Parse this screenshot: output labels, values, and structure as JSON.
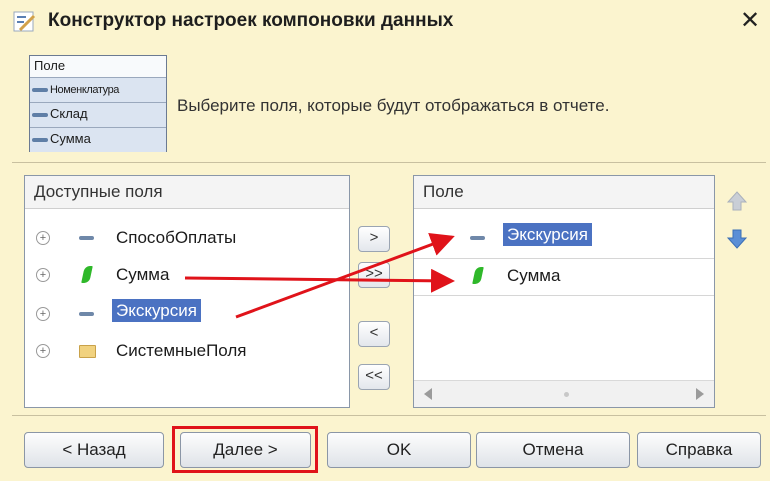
{
  "window": {
    "title": "Конструктор настроек компоновки данных",
    "close_symbol": "✕"
  },
  "illustration": {
    "header": "Поле",
    "rows": [
      "Номенклатура",
      "Склад",
      "Сумма"
    ]
  },
  "instruction": "Выберите поля, которые будут отображаться в отчете.",
  "available_fields": {
    "header": "Доступные поля",
    "items": [
      {
        "label": "СпособОплаты",
        "icon": "dash-icon",
        "selected": false
      },
      {
        "label": "Сумма",
        "icon": "resource-icon",
        "selected": false
      },
      {
        "label": "Экскурсия",
        "icon": "dash-icon",
        "selected": true
      },
      {
        "label": "СистемныеПоля",
        "icon": "folder-icon",
        "selected": false
      }
    ]
  },
  "transfer_buttons": {
    "add": ">",
    "add_all": ">>",
    "remove": "<",
    "remove_all": "<<"
  },
  "selected_fields": {
    "header": "Поле",
    "items": [
      {
        "label": "Экскурсия",
        "icon": "dash-icon",
        "selected": true
      },
      {
        "label": "Сумма",
        "icon": "resource-icon",
        "selected": false
      }
    ]
  },
  "footer": {
    "back": "< Назад",
    "next": "Далее >",
    "ok": "OK",
    "cancel": "Отмена",
    "help": "Справка"
  },
  "colors": {
    "background": "#fbf4cf",
    "selection": "#4b72c2",
    "annotation": "#e0131a"
  }
}
